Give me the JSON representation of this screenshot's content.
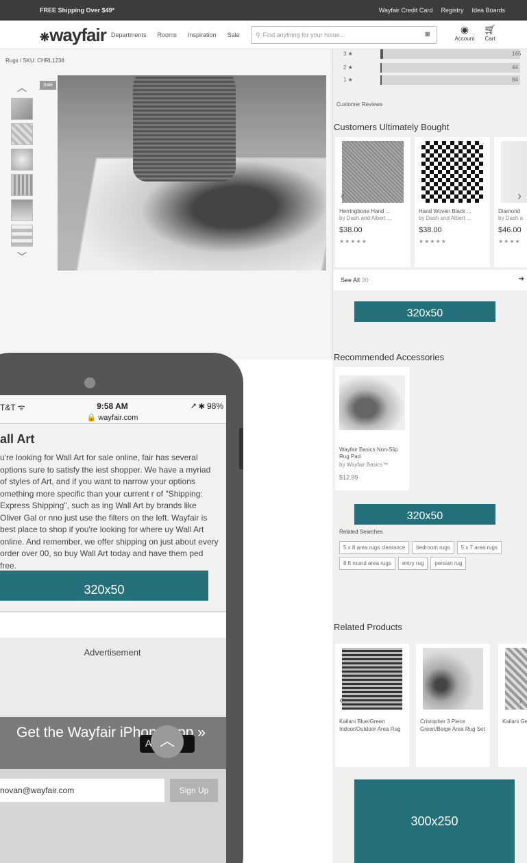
{
  "topbar": {
    "free_shipping": "FREE Shipping Over $49*",
    "links": [
      "Wayfair Credit Card",
      "Registry",
      "Idea Boards"
    ]
  },
  "header": {
    "logo": "wayfair",
    "nav": [
      "Departments",
      "Rooms",
      "Inspiration",
      "Sale"
    ],
    "search_placeholder": "Find anything for your home...",
    "account_label": "Account",
    "cart_label": "Cart"
  },
  "product": {
    "breadcrumb": "Rugs / SKU: CHRL1238",
    "badge": "Sale"
  },
  "ratings": [
    {
      "label": "3 ★",
      "fraction": 0.02,
      "count": "165"
    },
    {
      "label": "2 ★",
      "fraction": 0.01,
      "count": "44"
    },
    {
      "label": "1 ★",
      "fraction": 0.01,
      "count": "84"
    }
  ],
  "customer_reviews_label": "Customer Reviews",
  "customers_bought": {
    "title": "Customers Ultimately Bought",
    "items": [
      {
        "name": "Herringbone Hand ...",
        "by": "by Dash and Albert ...",
        "price": "$38.00",
        "stars": "★★★★★"
      },
      {
        "name": "Hand Woven Black ...",
        "by": "by Dash and Albert ...",
        "price": "$38.00",
        "stars": "★★★★★"
      },
      {
        "name": "Diamond",
        "by": "by Dash a",
        "price": "$46.00",
        "stars": "★★★★"
      }
    ],
    "see_all": "See All",
    "see_all_count": "30"
  },
  "ads": {
    "banner1": "320x50",
    "banner2": "320x50",
    "banner3": "320x50",
    "box": "300x250"
  },
  "accessories": {
    "title": "Recommended Accessories",
    "item": {
      "name": "Wayfair Basics Non-Slip Rug Pad",
      "by": "by Wayfair Basics™",
      "price": "$12.99"
    }
  },
  "related_searches": {
    "title": "Related Searches",
    "chips": [
      "5 x 8 area rugs clearance",
      "bedroom rugs",
      "5 x 7 area rugs",
      "8 ft round area rugs",
      "entry rug",
      "persian rug"
    ]
  },
  "related_products": {
    "title": "Related Products",
    "items": [
      {
        "name": "Kailani Blue/Green Indoor/Outdoor Area Rug"
      },
      {
        "name": "Cristopher 3 Piece Green/Beige Area Rug Set"
      },
      {
        "name": "Kailani Geomet Indoor/ Rug"
      }
    ]
  },
  "phone": {
    "carrier": "T&T ᯤ",
    "time": "9:58 AM",
    "battery": "⭧ ✱ 98%",
    "url": "🔒 wayfair.com",
    "heading": "all Art",
    "body": "u're looking for Wall Art for sale online, fair has several options sure to satisfy the iest shopper. We have a myriad of styles of Art, and if you want to narrow your options omething more specific than your current r of \"Shipping: Express Shipping\", such as ing Wall Art by brands like Oliver Gal or nno just use the filters on the left. Wayfair is best place to shop if you're looking for where uy Wall Art online. And remember, we offer shipping on just about every order over 00, so buy Wall Art today and have them ped free.",
    "ad_label": "Advertisement",
    "app_banner": "Get the Wayfair iPhone App »",
    "app_store": " A",
    "email": "novan@wayfair.com",
    "signup": "Sign Up"
  }
}
